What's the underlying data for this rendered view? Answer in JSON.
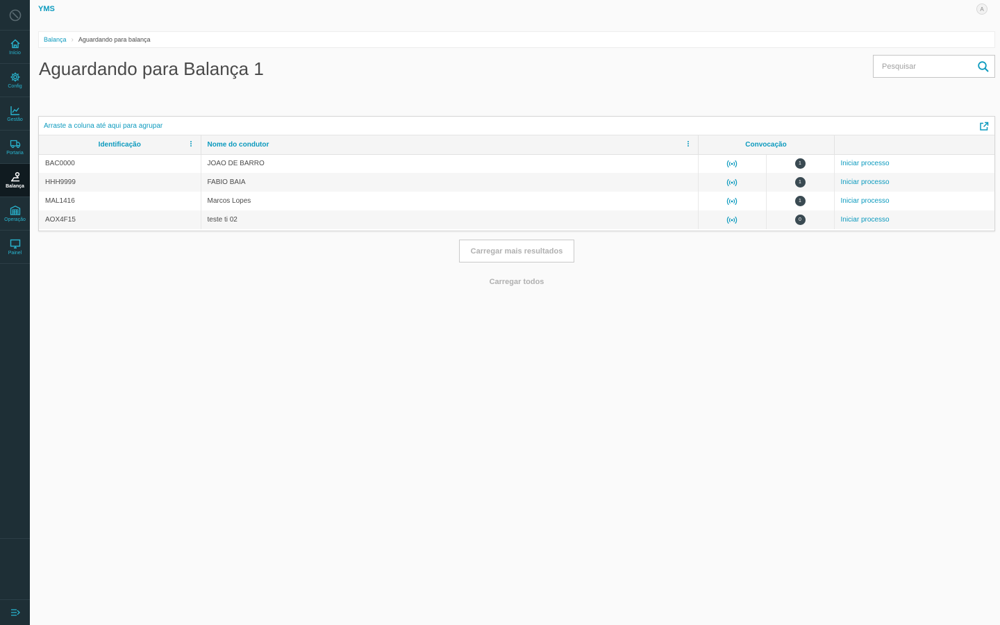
{
  "app": {
    "title": "YMS",
    "avatar_initial": "A"
  },
  "colors": {
    "sidebar_bg": "#1e2f36",
    "accent": "#0c9abe",
    "badge_bg": "#3a4a52"
  },
  "sidebar": {
    "items": [
      {
        "label": "Início",
        "icon": "home-icon",
        "active": false
      },
      {
        "label": "Config",
        "icon": "gear-icon",
        "active": false
      },
      {
        "label": "Gestão",
        "icon": "chart-icon",
        "active": false
      },
      {
        "label": "Portaria",
        "icon": "truck-icon",
        "active": false
      },
      {
        "label": "Balança",
        "icon": "scale-icon",
        "active": true
      },
      {
        "label": "Operação",
        "icon": "warehouse-icon",
        "active": false
      },
      {
        "label": "Painel",
        "icon": "monitor-icon",
        "active": false
      }
    ]
  },
  "breadcrumb": {
    "parent": "Balança",
    "current": "Aguardando para balança"
  },
  "page": {
    "title": "Aguardando para Balança 1"
  },
  "search": {
    "placeholder": "Pesquisar"
  },
  "grid": {
    "group_hint": "Arraste a coluna até aqui para agrupar",
    "columns": {
      "identificacao": "Identificação",
      "nome_condutor": "Nome do condutor",
      "convocacao": "Convocação"
    },
    "rows": [
      {
        "id": "BAC0000",
        "driver": "JOAO DE BARRO",
        "count": "1",
        "action": "Iniciar processo"
      },
      {
        "id": "HHH9999",
        "driver": "FABIO BAIA",
        "count": "1",
        "action": "Iniciar processo"
      },
      {
        "id": "MAL1416",
        "driver": "Marcos Lopes",
        "count": "1",
        "action": "Iniciar processo"
      },
      {
        "id": "AOX4F15",
        "driver": "teste ti 02",
        "count": "0",
        "action": "Iniciar processo"
      }
    ]
  },
  "actions": {
    "load_more": "Carregar mais resultados",
    "load_all": "Carregar todos"
  }
}
